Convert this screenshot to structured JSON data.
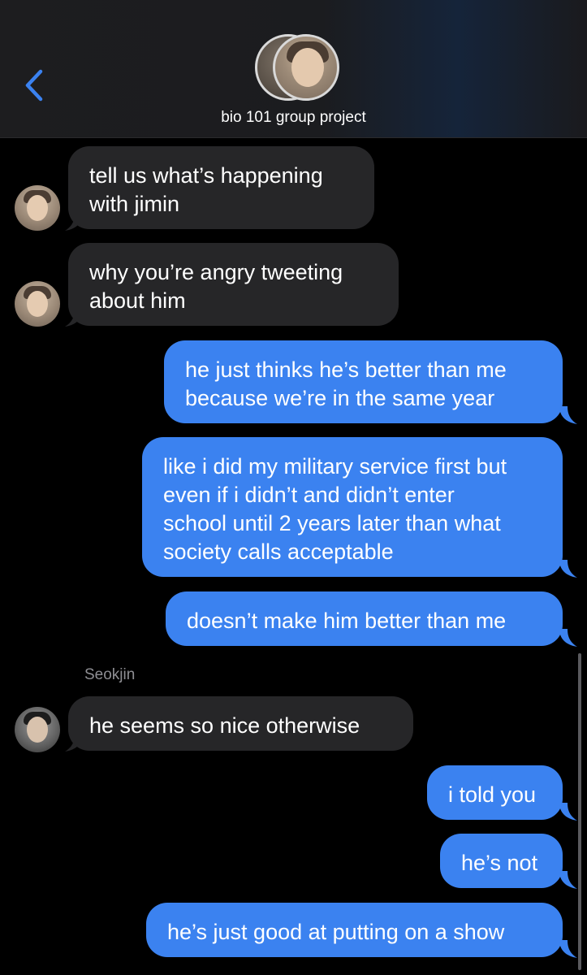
{
  "header": {
    "back_icon": "chevron-left-icon",
    "group_name": "bio 101 group project",
    "accent_color": "#3b82f0"
  },
  "messages": [
    {
      "direction": "incoming",
      "lines": [
        "tell us what’s happening",
        "with jimin"
      ]
    },
    {
      "direction": "incoming",
      "lines": [
        "why you’re angry tweeting",
        "about him"
      ]
    },
    {
      "direction": "outgoing",
      "lines": [
        "he just thinks he’s better than me",
        "because we’re in the same year"
      ]
    },
    {
      "direction": "outgoing",
      "lines": [
        "like i did my military service first but",
        "even if i didn’t and didn’t enter",
        "school until 2 years later than what",
        "society calls acceptable"
      ]
    },
    {
      "direction": "outgoing",
      "lines": [
        "doesn’t make him better than me"
      ]
    },
    {
      "direction": "incoming",
      "sender": "Seokjin",
      "lines": [
        "he seems so nice otherwise"
      ]
    },
    {
      "direction": "outgoing",
      "lines": [
        "i told you"
      ]
    },
    {
      "direction": "outgoing",
      "lines": [
        "he’s not"
      ]
    },
    {
      "direction": "outgoing",
      "lines": [
        "he’s just good at putting on a show"
      ]
    }
  ],
  "colors": {
    "incoming_bubble": "#262628",
    "outgoing_bubble": "#3b82f0",
    "background": "#000000",
    "sender_label": "#8e8e93"
  }
}
